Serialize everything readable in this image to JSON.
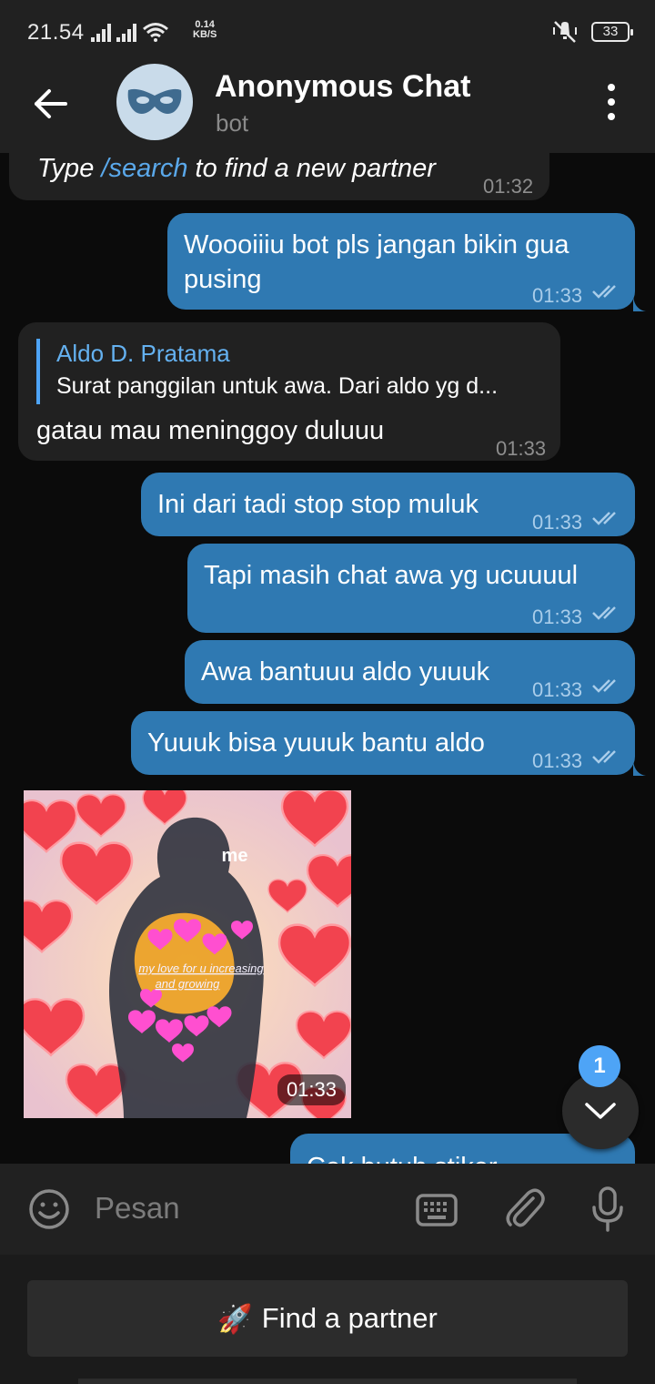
{
  "status_bar": {
    "time": "21.54",
    "speed_value": "0.14",
    "speed_unit": "KB/S",
    "battery": "33"
  },
  "header": {
    "title": "Anonymous Chat",
    "subtitle": "bot",
    "avatar_icon": "mask-icon"
  },
  "messages": [
    {
      "from": "bot",
      "text_pre": "Type ",
      "link": "/search",
      "text_post": " to find a new partner",
      "time": "01:32"
    },
    {
      "from": "me",
      "line1": "Woooiiiu bot pls jangan bikin gua",
      "line2": "pusing",
      "time": "01:33"
    },
    {
      "from": "bot",
      "reply_name": "Aldo D. Pratama",
      "reply_text": "Surat panggilan untuk awa.  Dari aldo yg d...",
      "text": "gatau mau meninggoy duluuu",
      "time": "01:33"
    },
    {
      "from": "me",
      "text": "Ini dari tadi stop stop muluk",
      "time": "01:33"
    },
    {
      "from": "me",
      "text": "Tapi masih chat awa yg ucuuuul",
      "time": "01:33"
    },
    {
      "from": "me",
      "text": "Awa bantuuu aldo yuuuk",
      "time": "01:33"
    },
    {
      "from": "me",
      "text": "Yuuuk bisa yuuuk bantu aldo",
      "time": "01:33"
    },
    {
      "from": "bot",
      "sticker_label": "me",
      "sticker_caption_1": "my love for u increasing",
      "sticker_caption_2": "and growing",
      "time": "01:33"
    },
    {
      "from": "me",
      "text": "Cek butuh stiker",
      "time": ""
    }
  ],
  "scroll_button": {
    "badge": "1"
  },
  "input": {
    "placeholder": "Pesan"
  },
  "keyboard_button": {
    "emoji": "🚀",
    "label": "Find a partner"
  },
  "colors": {
    "outgoing_bubble": "#2f79b2",
    "incoming_bubble": "#212121",
    "accent": "#4ea4f6",
    "background": "#0b0b0b"
  }
}
